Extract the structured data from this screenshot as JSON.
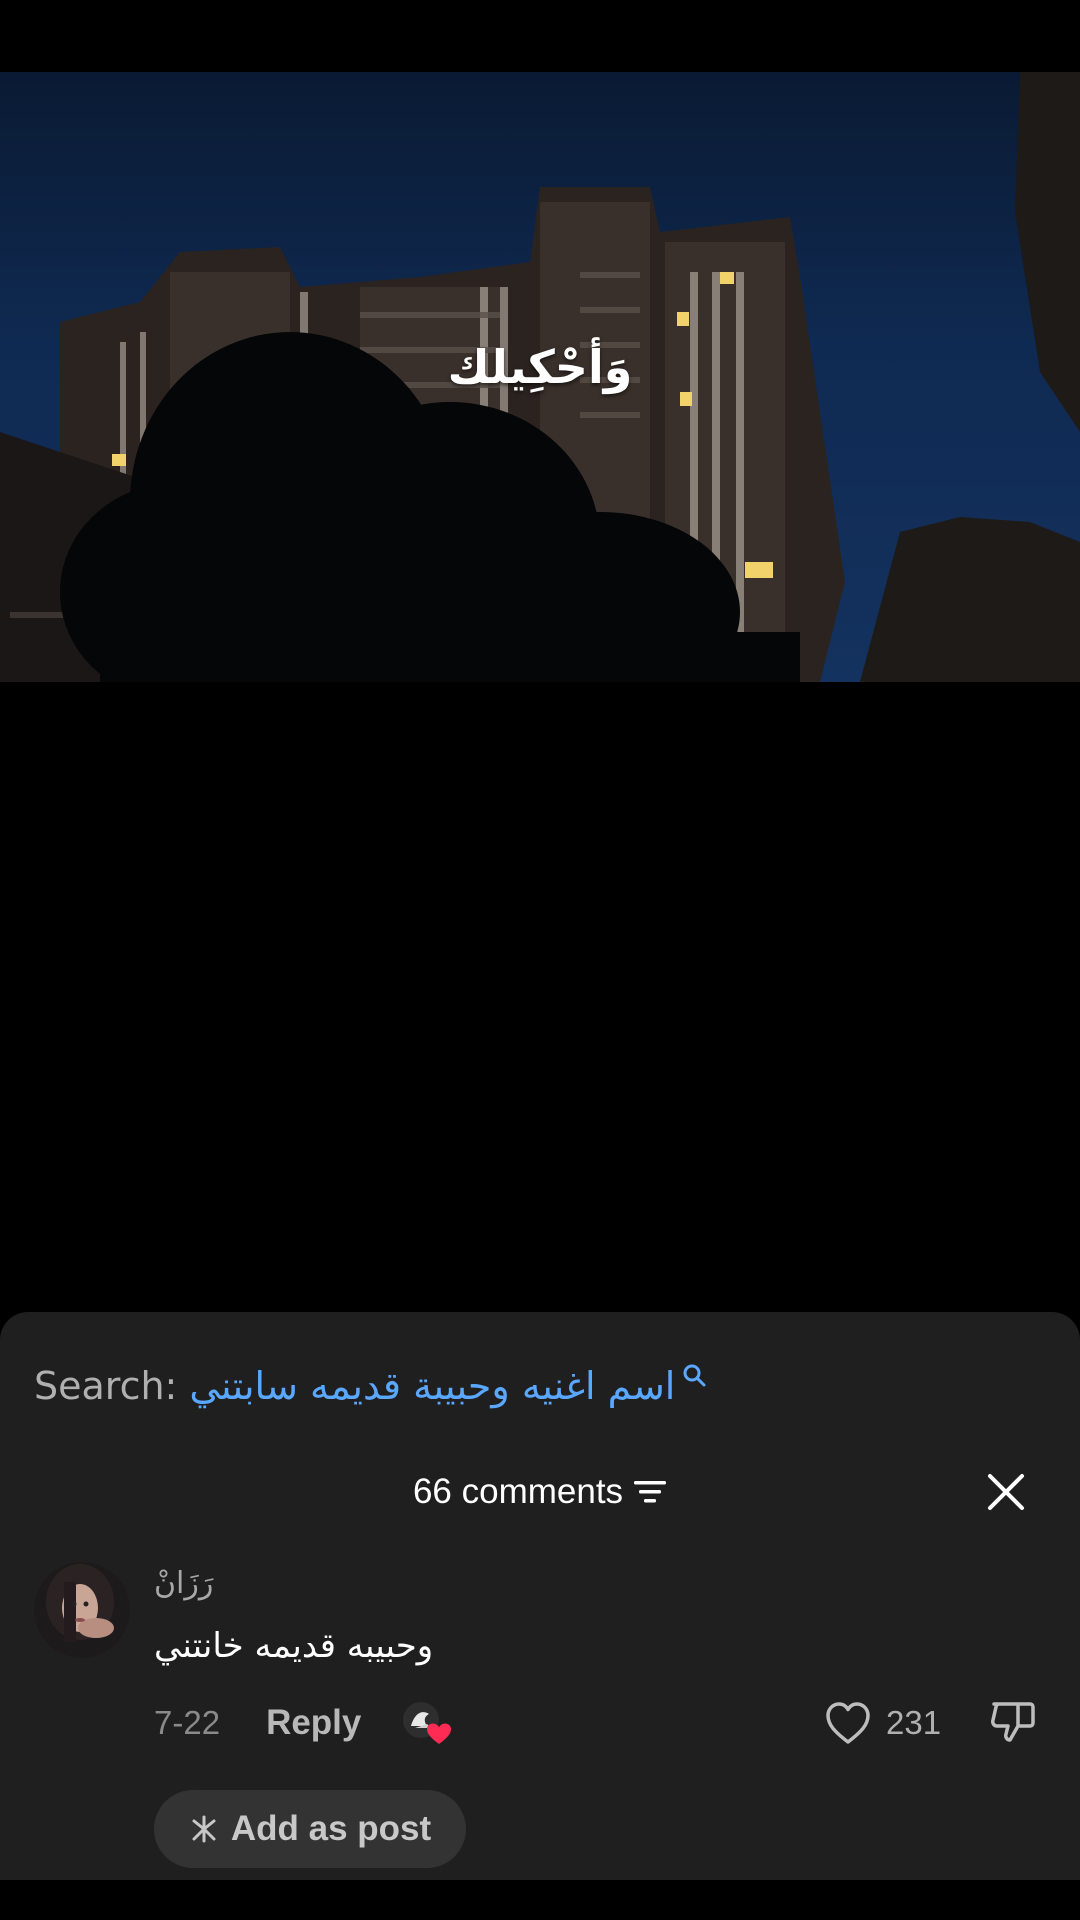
{
  "video": {
    "lyric": "وَأحْكِيلك"
  },
  "comments_panel": {
    "search_label": "Search:",
    "search_query": "اسم اغنيه وحبيبة قديمه سابتني",
    "comments_count": "66 comments",
    "comments": [
      {
        "username": "رَزَانْ",
        "text": "وحبيبه قديمه خانتني",
        "date": "7-22",
        "reply_label": "Reply",
        "like_count": "231",
        "add_as_post_label": "Add as post"
      }
    ]
  },
  "colors": {
    "sheet_background": "#1f1f1f",
    "search_query": "#5aa7ff",
    "creator_heart": "#fe2c55"
  },
  "icons": [
    "search-icon",
    "filter-icon",
    "close-icon",
    "heart-icon",
    "dislike-icon",
    "sparkle-icon",
    "creator-liked-icon"
  ]
}
